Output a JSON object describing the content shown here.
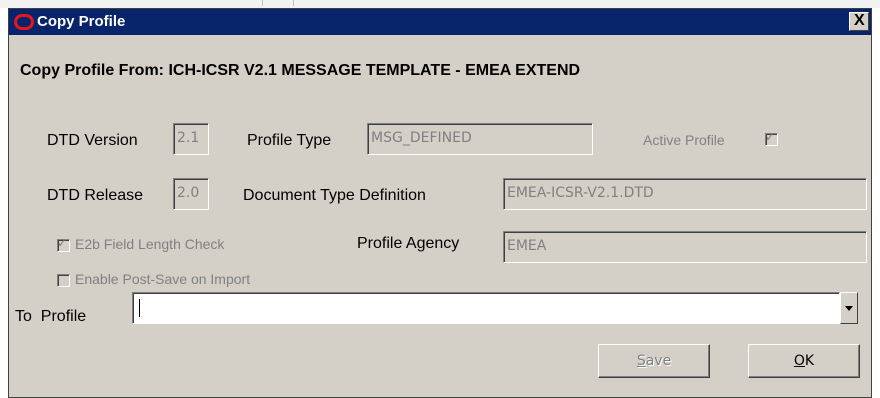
{
  "dialog": {
    "title": "Copy Profile",
    "close_label": "X",
    "heading": "Copy Profile From: ICH-ICSR V2.1 MESSAGE TEMPLATE - EMEA EXTEND"
  },
  "fields": {
    "dtd_version": {
      "label": "DTD Version",
      "value": "2.1"
    },
    "profile_type": {
      "label": "Profile Type",
      "value": "MSG_DEFINED"
    },
    "active_profile": {
      "label": "Active Profile",
      "checked": true
    },
    "dtd_release": {
      "label": "DTD Release",
      "value": "2.0"
    },
    "document_type_definition": {
      "label": "Document Type Definition",
      "value": "EMEA-ICSR-V2.1.DTD"
    },
    "e2b_field_length_check": {
      "label": "E2b Field Length Check",
      "checked": true
    },
    "profile_agency": {
      "label": "Profile Agency",
      "value": "EMEA"
    },
    "enable_post_save": {
      "label": "Enable Post-Save on Import",
      "checked": false
    },
    "to_profile": {
      "label": "To  Profile",
      "value": ""
    }
  },
  "buttons": {
    "save": {
      "first": "S",
      "rest": "ave"
    },
    "ok": {
      "first": "O",
      "rest": "K"
    }
  },
  "colors": {
    "titlebar": "#08246b",
    "dialog_bg": "#d4d0c8",
    "disabled_text": "#808080",
    "logo": "#e4161b"
  },
  "icons": {
    "logo": "oracle-logo-icon",
    "close": "close-icon",
    "dropdown": "chevron-down-icon"
  }
}
